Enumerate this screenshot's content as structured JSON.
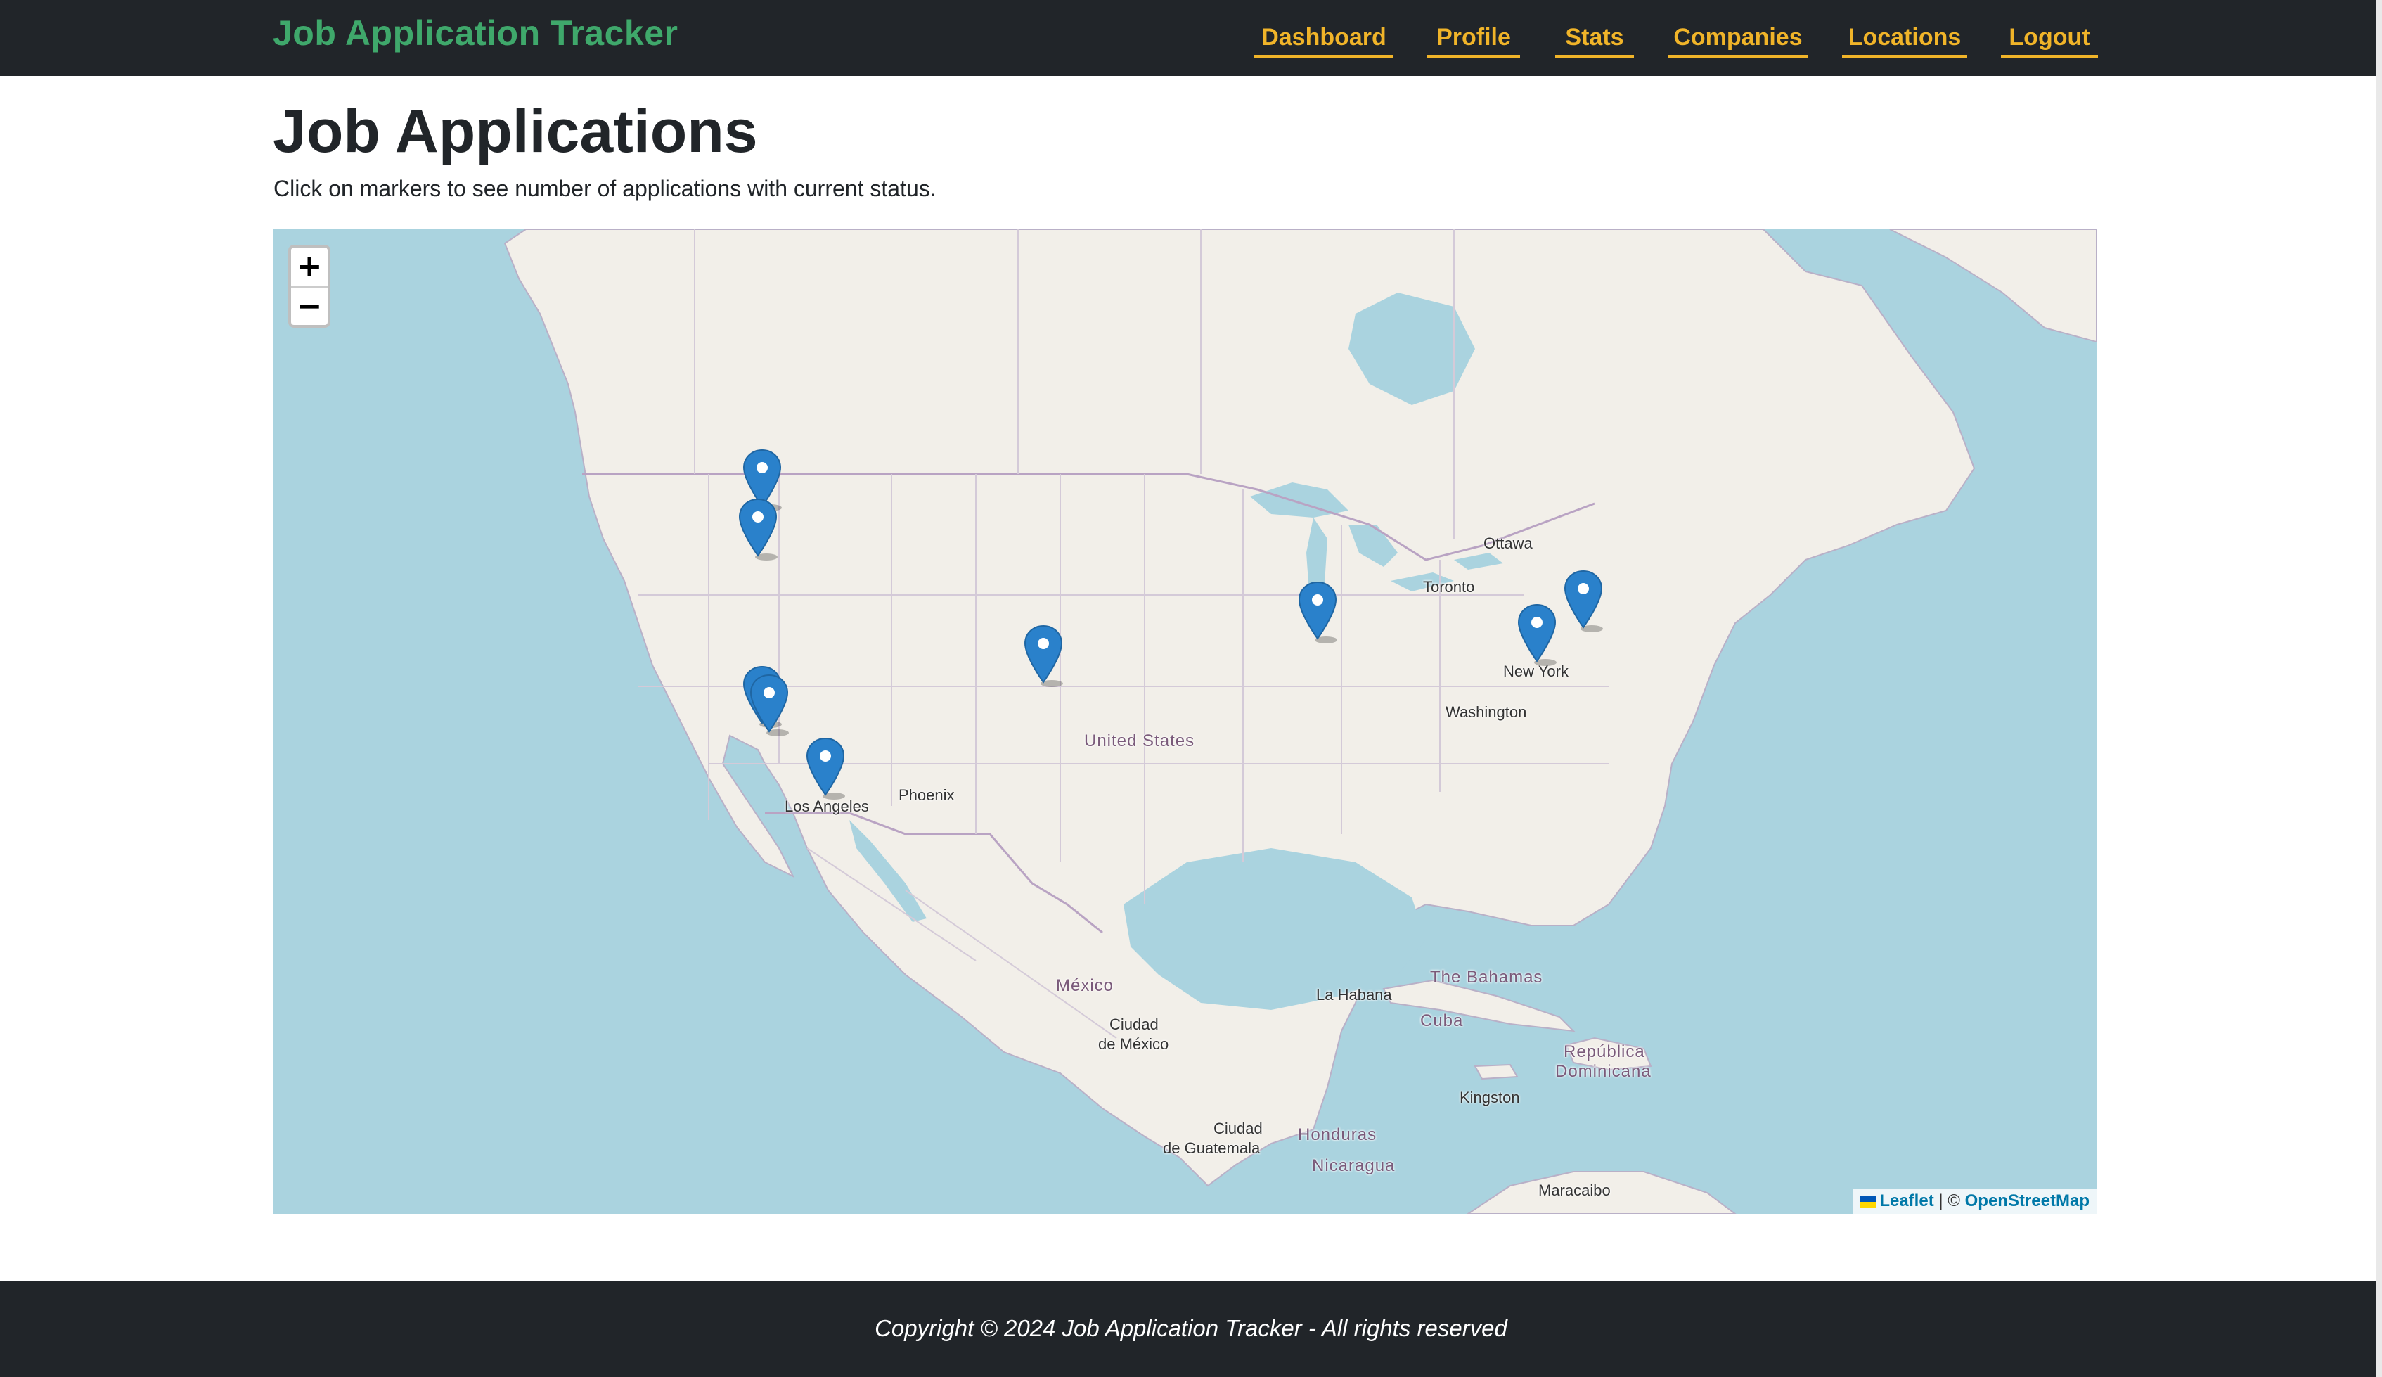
{
  "navbar": {
    "brand": "Job Application Tracker",
    "links": [
      "Dashboard",
      "Profile",
      "Stats",
      "Companies",
      "Locations",
      "Logout"
    ]
  },
  "page": {
    "title": "Job Applications",
    "instructions": "Click on markers to see number of applications with current status."
  },
  "map": {
    "zoom_in": "+",
    "zoom_out": "−",
    "attribution": {
      "leaflet": "Leaflet",
      "separator": "| ©",
      "osm": "OpenStreetMap"
    },
    "labels": {
      "ottawa": "Ottawa",
      "toronto": "Toronto",
      "new_york": "New York",
      "washington": "Washington",
      "united_states": "United States",
      "phoenix": "Phoenix",
      "los_angeles": "Los Angeles",
      "mexico": "México",
      "ciudad_de_mexico_1": "Ciudad",
      "ciudad_de_mexico_2": "de México",
      "la_habana": "La Habana",
      "cuba": "Cuba",
      "bahamas": "The Bahamas",
      "kingston": "Kingston",
      "republica_1": "República",
      "republica_2": "Dominicana",
      "guatemala_1": "Ciudad",
      "guatemala_2": "de Guatemala",
      "honduras": "Honduras",
      "nicaragua": "Nicaragua",
      "maracaibo": "Maracaibo"
    },
    "marker_count": 10
  },
  "footer": {
    "text": "Copyright © 2024 Job Application Tracker - All rights reserved"
  },
  "colors": {
    "navbar_bg": "#212529",
    "brand": "#3fa86b",
    "nav_link": "#f0b429",
    "water": "#aad3df",
    "land": "#f2efe9",
    "marker": "#2a81cb"
  }
}
